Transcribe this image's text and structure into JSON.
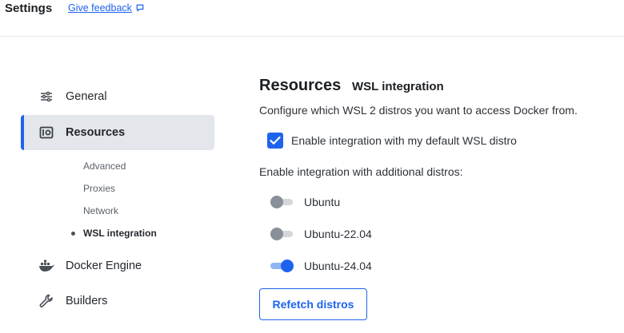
{
  "header": {
    "title": "Settings",
    "feedback_label": "Give feedback",
    "feedback_icon": "feedback-icon"
  },
  "sidebar": {
    "items": [
      {
        "label": "General",
        "icon": "sliders-icon",
        "active": false
      },
      {
        "label": "Resources",
        "icon": "resources-icon",
        "active": true
      },
      {
        "label": "Docker Engine",
        "icon": "whale-icon",
        "active": false
      },
      {
        "label": "Builders",
        "icon": "wrench-icon",
        "active": false
      }
    ],
    "sub_items": [
      {
        "label": "Advanced",
        "current": false
      },
      {
        "label": "Proxies",
        "current": false
      },
      {
        "label": "Network",
        "current": false
      },
      {
        "label": "WSL integration",
        "current": true
      }
    ]
  },
  "main": {
    "title": "Resources",
    "subtitle": "WSL integration",
    "description": "Configure which WSL 2 distros you want to access Docker from.",
    "default_distro_checkbox": {
      "label": "Enable integration with my default WSL distro",
      "checked": true
    },
    "additional_label": "Enable integration with additional distros:",
    "distros": [
      {
        "name": "Ubuntu",
        "enabled": false
      },
      {
        "name": "Ubuntu-22.04",
        "enabled": false
      },
      {
        "name": "Ubuntu-24.04",
        "enabled": true
      }
    ],
    "refetch_label": "Refetch distros"
  },
  "colors": {
    "accent": "#1d63ed",
    "active_nav_bg": "#e3e6ea",
    "toggle_off": "#8a9099"
  }
}
